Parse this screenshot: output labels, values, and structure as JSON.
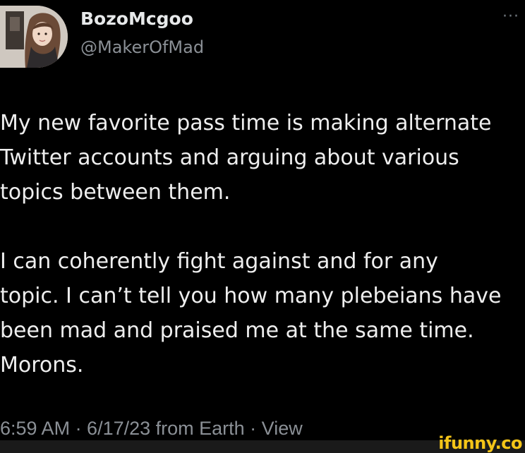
{
  "tweet": {
    "display_name": "BozoMcgoo",
    "handle": "@MakerOfMad",
    "more_glyph": "···",
    "text": "My new favorite pass time is making alternate\nTwitter accounts and arguing about various\ntopics between them.\n\nI can coherently fight against and for any\ntopic. I can’t tell you how many plebeians have\nbeen mad and praised me at the same time.\nMorons.",
    "meta": "6:59 AM · 6/17/23 from Earth · View"
  },
  "watermark": "ifunny.co",
  "colors": {
    "background": "#000000",
    "text": "#eeeeee",
    "secondary_text": "#8b9096",
    "watermark": "#f5c518"
  },
  "icons": {
    "more": "more-horizontal-icon",
    "avatar": "profile-photo"
  }
}
